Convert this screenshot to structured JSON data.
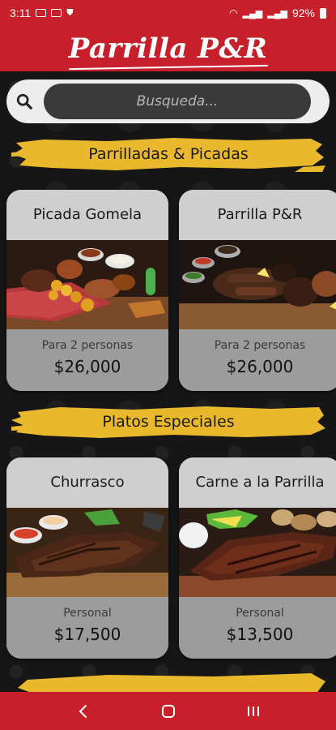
{
  "status": {
    "time": "3:11",
    "battery": "92%"
  },
  "header": {
    "title": "Parrilla P&R"
  },
  "search": {
    "placeholder": "Busqueda..."
  },
  "sections": [
    {
      "title": "Parrilladas & Picadas",
      "items": [
        {
          "name": "Picada Gomela",
          "subtitle": "Para 2 personas",
          "price": "$26,000"
        },
        {
          "name": "Parrilla P&R",
          "subtitle": "Para 2 personas",
          "price": "$26,000"
        }
      ]
    },
    {
      "title": "Platos Especiales",
      "items": [
        {
          "name": "Churrasco",
          "subtitle": "Personal",
          "price": "$17,500"
        },
        {
          "name": "Carne a la Parrilla",
          "subtitle": "Personal",
          "price": "$13,500"
        }
      ]
    }
  ],
  "colors": {
    "brand_red": "#c8202b",
    "banner_yellow": "#e9b82c",
    "card_gray": "#d4d4d4"
  },
  "icons": [
    "search-icon",
    "back-icon",
    "home-icon",
    "recents-icon"
  ]
}
